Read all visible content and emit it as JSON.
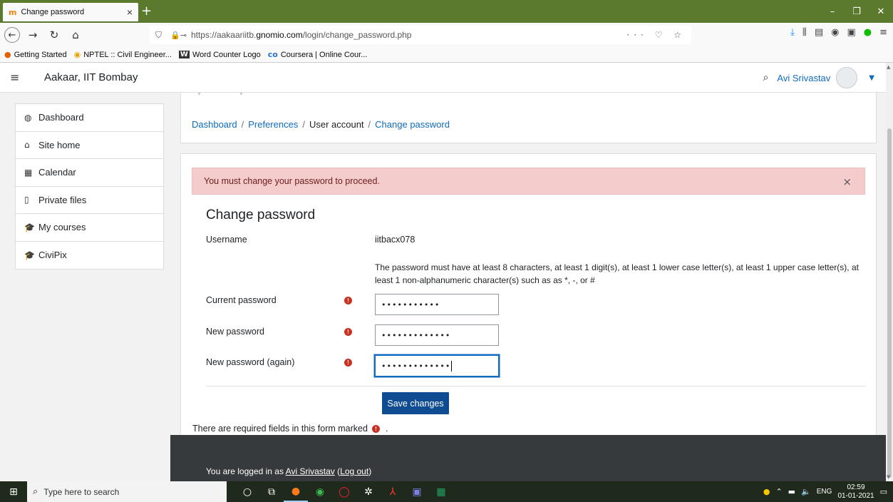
{
  "browser": {
    "tab_title": "Change password",
    "tab_favicon": "m",
    "new_tab_glyph": "+",
    "url_prefix": "https://aakaariitb.",
    "url_domain": "gnomio.com",
    "url_path": "/login/change_password.php",
    "url_actions": "··· ♡ ☆",
    "window_controls": [
      "–",
      "❐",
      "✕"
    ]
  },
  "bookmarks": [
    {
      "label": "Getting Started",
      "icon": "firefox-icon",
      "glyph": "●"
    },
    {
      "label": "NPTEL :: Civil Engineer...",
      "icon": "nptel-icon",
      "glyph": "◉"
    },
    {
      "label": "Word Counter Logo",
      "icon": "word-icon",
      "glyph": "W"
    },
    {
      "label": "Coursera | Online Cour...",
      "icon": "coursera-icon",
      "glyph": "co"
    }
  ],
  "header": {
    "site_name": "Aakaar, IIT Bombay",
    "user_name": "Avi Srivastav"
  },
  "sidebar": {
    "items": [
      {
        "label": "Dashboard",
        "icon": "dashboard-icon",
        "glyph": "◍"
      },
      {
        "label": "Site home",
        "icon": "home-icon",
        "glyph": "⌂"
      },
      {
        "label": "Calendar",
        "icon": "calendar-icon",
        "glyph": "▦"
      },
      {
        "label": "Private files",
        "icon": "file-icon",
        "glyph": "▯"
      },
      {
        "label": "My courses",
        "icon": "graduation-cap-icon",
        "glyph": "🎓"
      },
      {
        "label": "CiviPix",
        "icon": "graduation-cap-icon",
        "glyph": "🎓"
      }
    ]
  },
  "breadcrumb": {
    "items": [
      "Dashboard",
      "Preferences",
      "User account",
      "Change password"
    ],
    "separator": "/"
  },
  "alert": {
    "message": "You must change your password to proceed.",
    "close": "×"
  },
  "form": {
    "title": "Change password",
    "username_label": "Username",
    "username_value": "iitbacx078",
    "policy": "The password must have at least 8 characters, at least 1 digit(s), at least 1 lower case letter(s), at least 1 upper case letter(s), at least 1 non-alphanumeric character(s) such as as *, -, or #",
    "required_glyph": "!",
    "fields": [
      {
        "label": "Current password",
        "value": "•••••••••••"
      },
      {
        "label": "New password",
        "value": "•••••••••••••"
      },
      {
        "label": "New password (again)",
        "value": "•••••••••••••"
      }
    ],
    "save_label": "Save changes",
    "required_note_before": "There are required fields in this form marked",
    "required_note_after": "."
  },
  "footer": {
    "prefix": "You are logged in as ",
    "user_link": "Avi Srivastav",
    "open_paren": " (",
    "logout_link": "Log out",
    "close_paren": ")"
  },
  "taskbar": {
    "search_placeholder": "Type here to search",
    "language": "ENG",
    "time": "02:59",
    "date": "01-01-2021"
  },
  "colors": {
    "accent": "#0f6cbf",
    "save_button": "#0f4c91",
    "alert_bg": "#f4cccc",
    "required": "#ca3120",
    "footer_bg": "#373a3c",
    "browser_frame": "#5c7a2e"
  }
}
